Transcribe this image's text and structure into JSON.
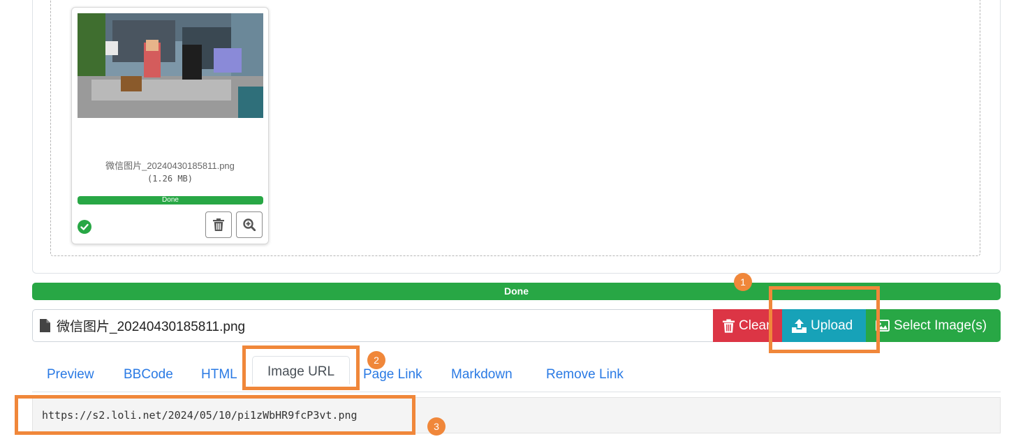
{
  "thumbnail": {
    "file_name": "微信图片_20240430185811.png",
    "file_size": "(1.26 MB)",
    "progress_label": "Done",
    "progress_value": 1.0,
    "status_icon": "check-circle-icon",
    "buttons": {
      "delete_icon": "trash-icon",
      "zoom_icon": "zoom-in-icon"
    }
  },
  "upload": {
    "progress_label": "Done",
    "progress_value": 1.0,
    "caption": "微信图片_20240430185811.png",
    "caption_icon": "file-icon",
    "buttons": {
      "clear": {
        "label": "Clear",
        "icon": "trash-icon",
        "color": "#dc3545"
      },
      "upload": {
        "label": "Upload",
        "icon": "upload-icon",
        "color": "#17a2b8"
      },
      "select": {
        "label": "Select Image(s)",
        "icon": "image-icon",
        "color": "#28a745"
      }
    }
  },
  "tabs": [
    {
      "label": "Preview"
    },
    {
      "label": "BBCode"
    },
    {
      "label": "HTML"
    },
    {
      "label": "Image URL",
      "active": true
    },
    {
      "label": "Page Link"
    },
    {
      "label": "Markdown"
    },
    {
      "label": "Remove Link"
    }
  ],
  "output": {
    "value": "https://s2.loli.net/2024/05/10/pi1zWbHR9fcP3vt.png"
  },
  "annotations": {
    "color": "#f0873a",
    "badges": [
      "1",
      "2",
      "3"
    ]
  },
  "colors": {
    "success": "#28a745",
    "danger": "#dc3545",
    "info": "#17a2b8",
    "link": "#2a7ae4"
  }
}
